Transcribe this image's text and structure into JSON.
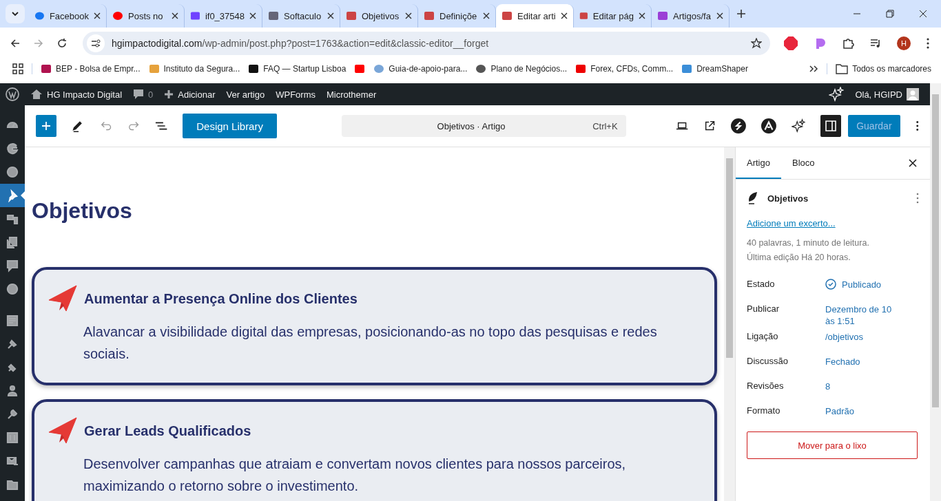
{
  "browser": {
    "tabs": [
      {
        "title": "Facebook",
        "selected": false
      },
      {
        "title": "Posts no",
        "selected": false
      },
      {
        "title": "if0_37548",
        "selected": false
      },
      {
        "title": "Softaculo",
        "selected": false
      },
      {
        "title": "Objetivos",
        "selected": false
      },
      {
        "title": "Definiçõe",
        "selected": false
      },
      {
        "title": "Editar arti",
        "selected": true
      },
      {
        "title": "Editar pág",
        "selected": false
      },
      {
        "title": "Artigos/fa",
        "selected": false
      }
    ],
    "url_host": "hgimpactodigital.com",
    "url_path": "/wp-admin/post.php?post=1763&action=edit&classic-editor__forget",
    "profile_initial": "H",
    "bookmarks": [
      {
        "kind": "text",
        "label": "BEP - Bolsa de Empr..."
      },
      {
        "kind": "text",
        "label": "Instituto da Segura..."
      },
      {
        "kind": "text",
        "label": "FAQ — Startup Lisboa"
      },
      {
        "kind": "icon_only"
      },
      {
        "kind": "text",
        "label": "Guia-de-apoio-para..."
      },
      {
        "kind": "text",
        "label": "Plano de Negócios..."
      },
      {
        "kind": "text",
        "label": "Forex, CFDs, Comm..."
      },
      {
        "kind": "text",
        "label": "DreamShaper"
      }
    ],
    "all_bookmarks": "Todos os marcadores"
  },
  "admin_bar": {
    "site": "HG Impacto Digital",
    "comments": "0",
    "items": [
      "Adicionar",
      "Ver artigo",
      "WPForms",
      "Microthemer"
    ],
    "greeting": "Olá, HGIPD"
  },
  "admin_menu": [
    {
      "selected": false
    },
    {
      "selected": false
    },
    {
      "selected": false
    },
    {
      "selected": true
    },
    {
      "selected": false
    },
    {
      "selected": false
    },
    {
      "selected": false
    },
    {
      "selected": false
    },
    {
      "selected": false
    },
    {
      "selected": false
    },
    {
      "selected": false
    },
    {
      "selected": false
    },
    {
      "selected": false
    },
    {
      "selected": false
    },
    {
      "selected": false
    },
    {
      "selected": false
    }
  ],
  "toolbar": {
    "undo_disabled": true,
    "redo_disabled": true,
    "design_library": "Design Library",
    "command_title": "Objetivos · Artigo",
    "shortcut": "Ctrl+K",
    "sidebar_open": true,
    "save": {
      "label": "Guardar",
      "disabled": true
    }
  },
  "post": {
    "title": "Objetivos",
    "cards": [
      {
        "heading": "Aumentar a Presença Online dos Clientes",
        "text": "Alavancar a visibilidade digital das empresas, posicionando-as no topo das pesquisas e redes sociais."
      },
      {
        "heading": "Gerar Leads Qualificados",
        "text": "Desenvolver campanhas que atraiam e convertam novos clientes para nossos parceiros, maximizando o retorno sobre o investimento."
      }
    ]
  },
  "settings": {
    "tabs": [
      {
        "label": "Artigo",
        "selected": true
      },
      {
        "label": "Bloco",
        "selected": false
      }
    ],
    "post_title": "Objetivos",
    "excerpt_link": "Adicione um excerto...",
    "stats": [
      "40 palavras, 1 minuto de leitura.",
      "Última edição Há 20 horas."
    ],
    "rows": [
      {
        "label": "Estado",
        "value": "Publicado",
        "kind": "status"
      },
      {
        "label": "Publicar",
        "value": "Dezembro de 10 às 1:51",
        "kind": "link"
      },
      {
        "label": "Ligação",
        "value": "/objetivos",
        "kind": "link"
      },
      {
        "label": "Discussão",
        "value": "Fechado",
        "kind": "link"
      },
      {
        "label": "Revisões",
        "value": "8",
        "kind": "link"
      },
      {
        "label": "Formato",
        "value": "Padrão",
        "kind": "link"
      }
    ],
    "trash": "Mover para o lixo"
  }
}
